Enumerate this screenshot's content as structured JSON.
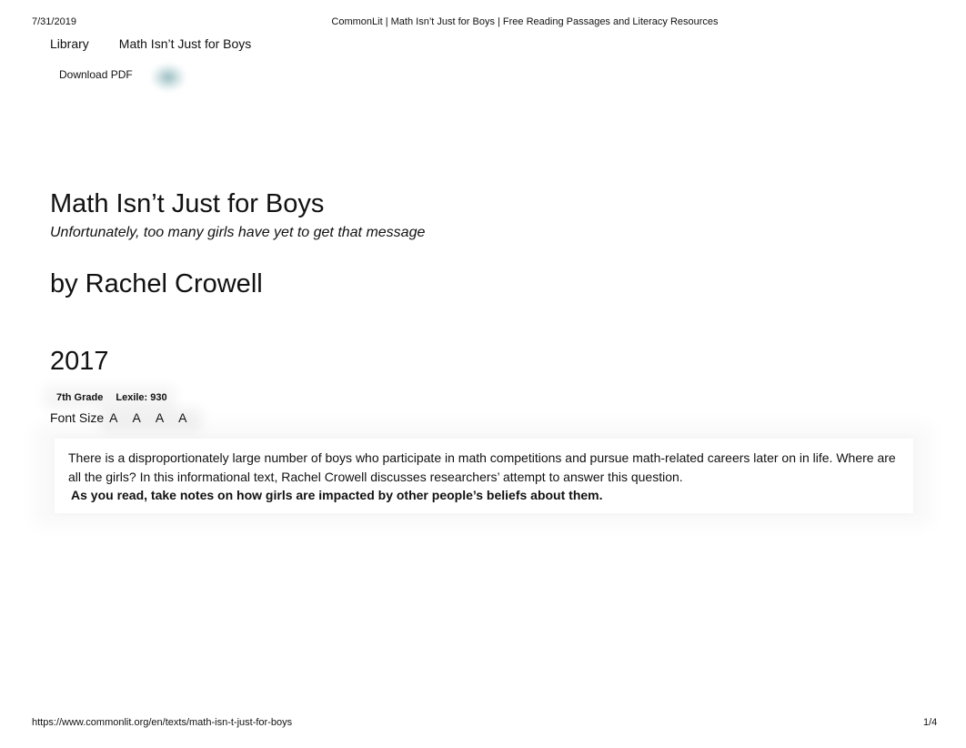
{
  "print_header": {
    "date": "7/31/2019",
    "title": "CommonLit | Math Isn’t Just for Boys | Free Reading Passages and Literacy Resources"
  },
  "breadcrumb": {
    "items": [
      {
        "label": "Library"
      },
      {
        "label": "Math Isn’t Just for Boys"
      }
    ]
  },
  "actions": {
    "download_label": "Download PDF",
    "share_icon": "share-icon"
  },
  "text": {
    "title": "Math Isn’t Just for Boys",
    "subtitle": "Unfortunately, too many girls have yet to get that message",
    "author": "by Rachel Crowell",
    "year": "2017",
    "badges": {
      "grade": "7th Grade",
      "lexile": "Lexile: 930"
    }
  },
  "font_size": {
    "label": "Font Size",
    "options": [
      "A",
      "A",
      "A",
      "A"
    ]
  },
  "intro": {
    "body": "There is a disproportionately large number of boys who participate in math competitions and pursue math-related careers later on in life. Where are all the girls? In this informational text, Rachel Crowell discusses researchers’ attempt to answer this question.",
    "note": "As you read, take notes on how girls are impacted by other people’s beliefs about them."
  },
  "print_footer": {
    "url": "https://www.commonlit.org/en/texts/math-isn-t-just-for-boys",
    "page": "1/4"
  }
}
